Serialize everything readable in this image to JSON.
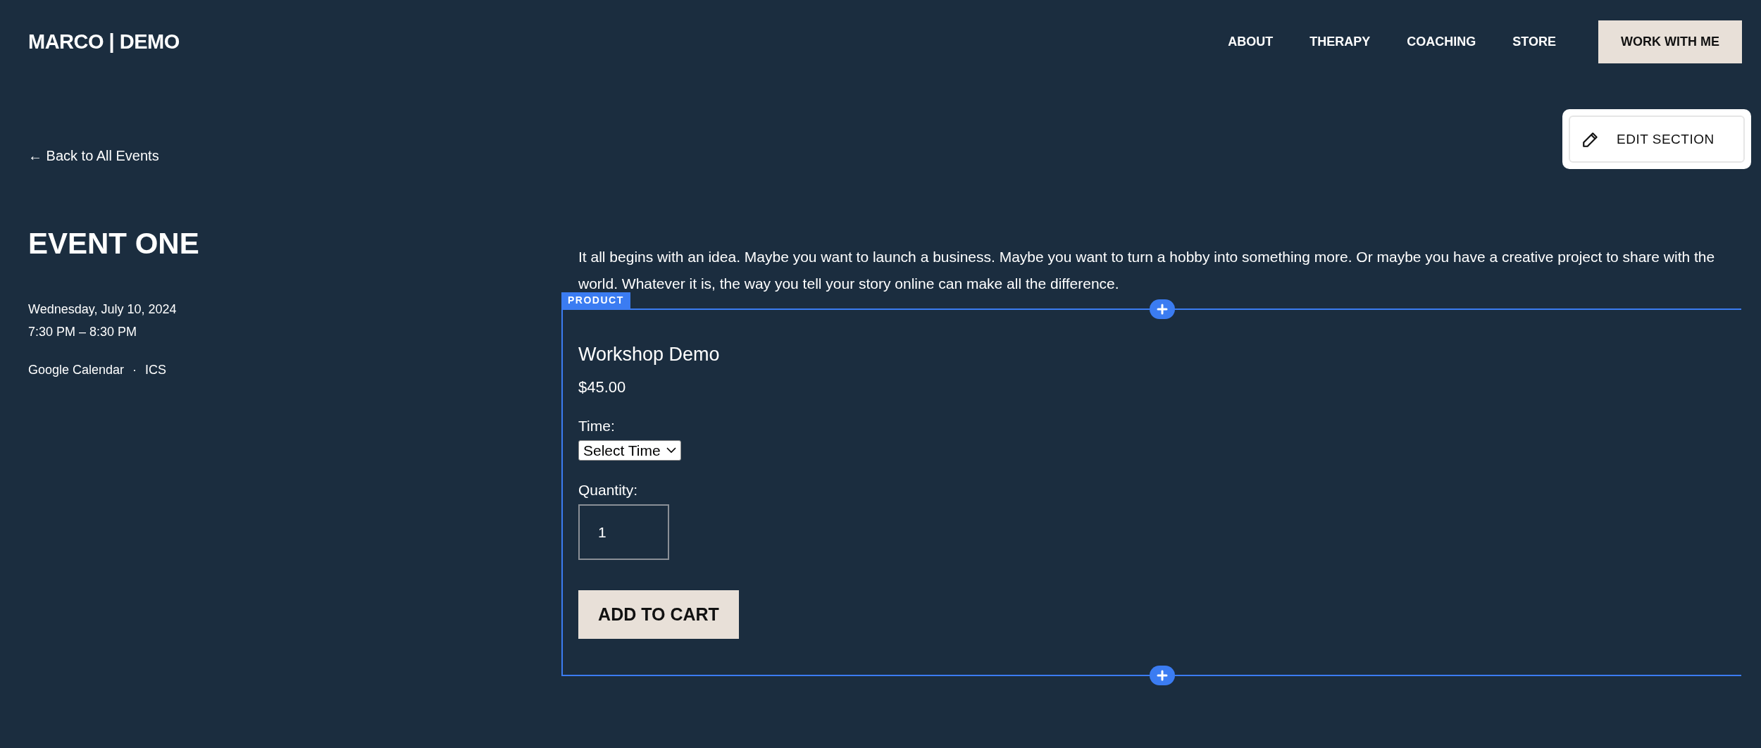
{
  "header": {
    "logo": "MARCO | DEMO",
    "nav": [
      "ABOUT",
      "THERAPY",
      "COACHING",
      "STORE"
    ],
    "cta": "WORK WITH ME"
  },
  "edit_section": {
    "label": "EDIT SECTION"
  },
  "back_link": "← Back to All Events",
  "event": {
    "title": "EVENT ONE",
    "date": "Wednesday, July 10, 2024",
    "time": "7:30 PM – 8:30 PM",
    "links": [
      "Google Calendar",
      "ICS"
    ],
    "separator": "·"
  },
  "description": "It all begins with an idea. Maybe you want to launch a business. Maybe you want to turn a hobby into something more. Or maybe you have a creative project to share with the world. Whatever it is, the way you tell your story online can make all the difference.",
  "product_block": {
    "tag": "PRODUCT"
  },
  "product": {
    "name": "Workshop Demo",
    "price": "$45.00",
    "time_label": "Time:",
    "time_select": {
      "value": "Select Time"
    },
    "quantity_label": "Quantity:",
    "quantity": {
      "value": "1"
    },
    "add_to_cart": "ADD TO CART"
  }
}
